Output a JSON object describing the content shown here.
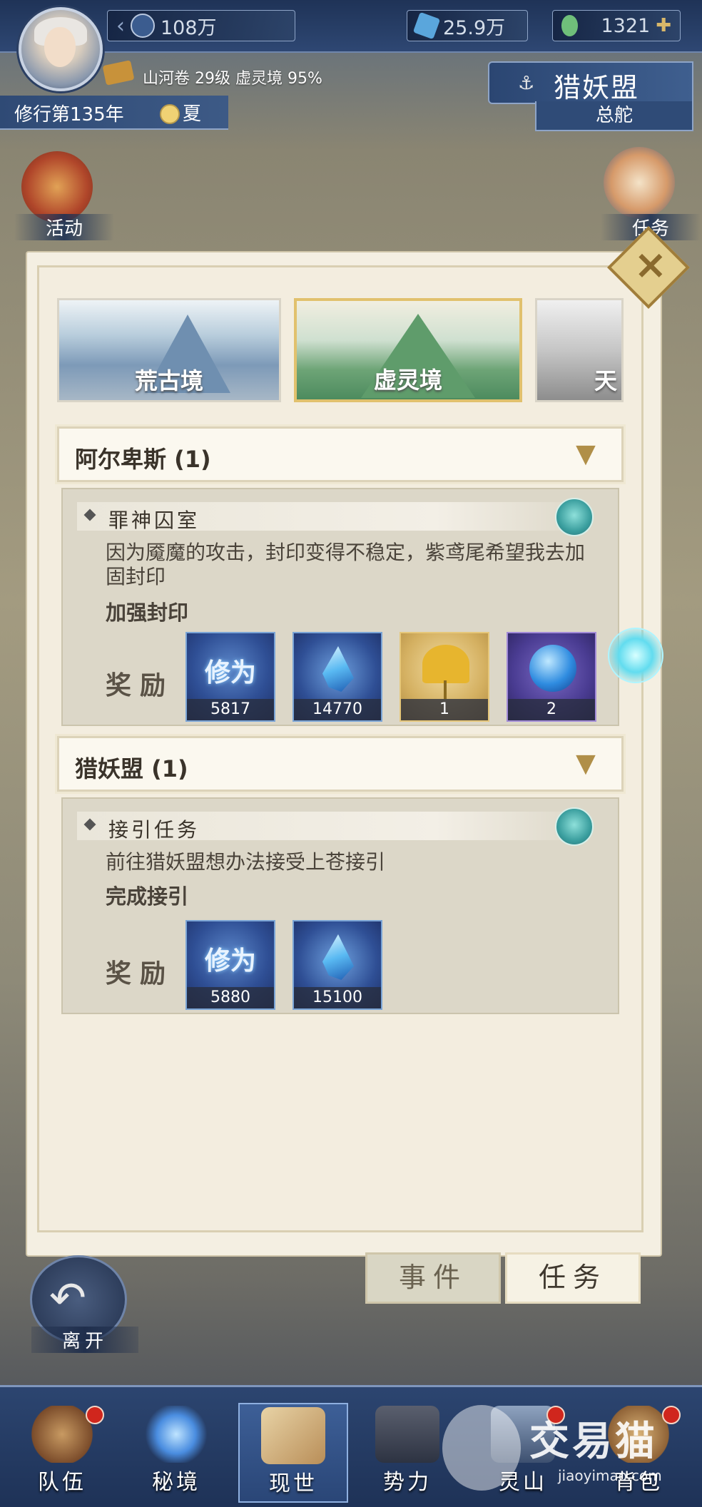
{
  "top": {
    "currency1": "108万",
    "currency2": "25.9万",
    "currency3": "1321",
    "info": "山河卷 29级 虚灵境 95%",
    "cultivation": "修行第135年",
    "season": "夏"
  },
  "faction": {
    "name": "猎妖盟",
    "sub": "总舵"
  },
  "side": {
    "activity": "活动",
    "task": "任务"
  },
  "tabs": [
    {
      "label": "荒古境"
    },
    {
      "label": "虚灵境"
    },
    {
      "label": "天"
    }
  ],
  "groups": [
    {
      "title": "阿尔卑斯 (1)",
      "quest": {
        "name": "罪神囚室",
        "desc": "因为魇魔的攻击，封印变得不稳定，紫鸢尾希望我去加固封印",
        "goal": "加强封印",
        "reward_label": "奖励",
        "rewards": [
          {
            "icon": "xiuwei-icon",
            "glyph": "修为",
            "count": "5817"
          },
          {
            "icon": "crystal-icon",
            "count": "14770"
          },
          {
            "icon": "ginkgo-leaf-icon",
            "count": "1"
          },
          {
            "icon": "spirit-orb-icon",
            "count": "2"
          }
        ]
      }
    },
    {
      "title": "猎妖盟 (1)",
      "quest": {
        "name": "接引任务",
        "desc": "前往猎妖盟想办法接受上苍接引",
        "goal": "完成接引",
        "reward_label": "奖励",
        "rewards": [
          {
            "icon": "xiuwei-icon",
            "glyph": "修为",
            "count": "5880"
          },
          {
            "icon": "crystal-icon",
            "count": "15100"
          }
        ]
      }
    }
  ],
  "bottom_tabs": {
    "event": "事件",
    "task": "任务"
  },
  "leave": "离开",
  "nav": [
    {
      "label": "队伍"
    },
    {
      "label": "秘境"
    },
    {
      "label": "现世"
    },
    {
      "label": "势力"
    },
    {
      "label": "灵山"
    },
    {
      "label": "背包"
    }
  ],
  "watermark": {
    "brand": "交易猫",
    "url": "jiaoyimao.com"
  },
  "colors": {
    "panel": "#f3eddf",
    "accent_gold": "#e1c16d",
    "nav_blue": "#2c4570",
    "badge_red": "#d0261d"
  }
}
